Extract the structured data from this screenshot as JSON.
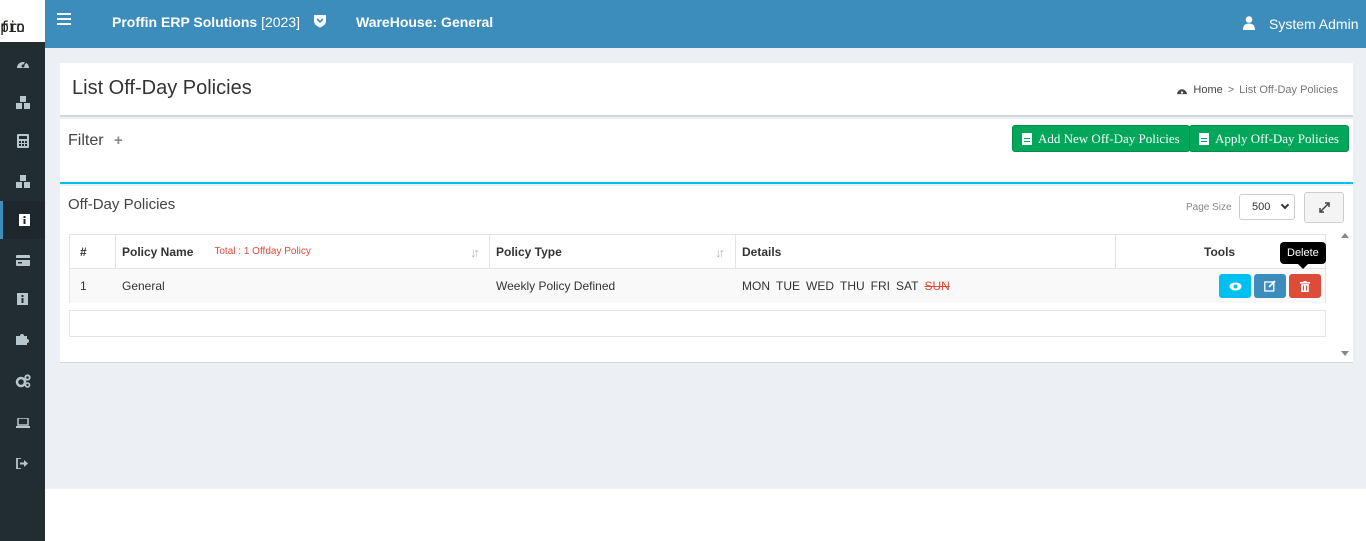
{
  "logo": {
    "text_a": "pro",
    "text_b": "f",
    "text_c": "fin"
  },
  "topbar": {
    "company": "Proffin ERP Solutions",
    "year": "[2023]",
    "warehouse": "WareHouse: General",
    "user": "System Admin"
  },
  "sidebar": {
    "icons": [
      "dashboard-icon",
      "cubes-icon",
      "calculator-icon",
      "cubes-icon",
      "info-icon",
      "credit-card-icon",
      "info-icon",
      "puzzle-icon",
      "cogs-icon",
      "laptop-icon",
      "sign-out-icon"
    ],
    "active_index": 4
  },
  "page": {
    "title": "List Off-Day Policies",
    "breadcrumb": {
      "home": "Home",
      "sep": ">",
      "current": "List Off-Day Policies"
    }
  },
  "filter": {
    "title": "Filter",
    "plus": "+",
    "add_button": "Add New Off-Day Policies",
    "apply_button": "Apply Off-Day Policies"
  },
  "table": {
    "title": "Off-Day Policies",
    "page_size_label": "Page Size",
    "page_size_value": "500",
    "headers": {
      "num": "#",
      "policy_name": "Policy Name",
      "total": "Total : 1 Offday Policy",
      "policy_type": "Policy Type",
      "details": "Details",
      "tools": "Tools"
    },
    "rows": [
      {
        "num": "1",
        "name": "General",
        "type": "Weekly Policy Defined",
        "days": [
          "MON",
          "TUE",
          "WED",
          "THU",
          "FRI",
          "SAT"
        ],
        "off_day": "SUN"
      }
    ]
  },
  "tooltip": "Delete",
  "colors": {
    "topbar": "#3c8dbc",
    "sidebar": "#222d32",
    "green": "#00a65a",
    "info": "#00c0ef",
    "primary": "#3c8dbc",
    "danger": "#dd4b39"
  }
}
